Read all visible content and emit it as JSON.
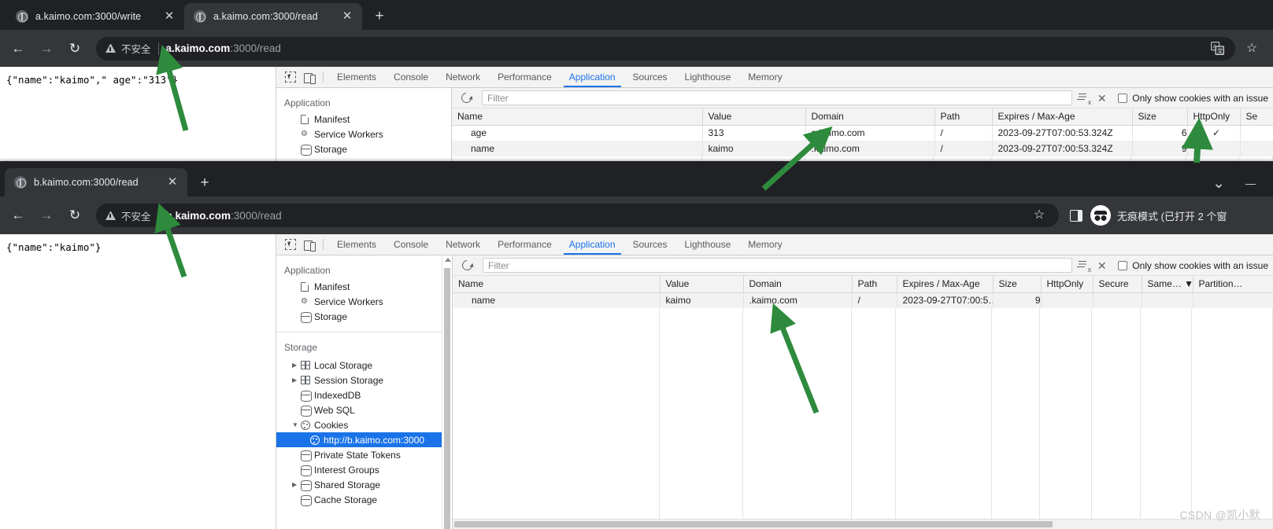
{
  "window_top": {
    "tabs": [
      {
        "title": "a.kaimo.com:3000/write",
        "active": false,
        "favicon": "globe-icon",
        "close": "✕"
      },
      {
        "title": "a.kaimo.com:3000/read",
        "active": true,
        "favicon": "globe-icon",
        "close": "✕"
      }
    ],
    "new_tab_label": "+",
    "toolbar": {
      "back": "←",
      "forward": "→",
      "reload": "↻",
      "not_secure_text": "不安全",
      "url_host": "a.kaimo.com",
      "url_rest": ":3000/read",
      "translate_icon": "translate-icon",
      "star": "☆"
    },
    "page_body": "{\"name\":\"kaimo\",\" age\":\"313\"}",
    "devtools": {
      "tabs": [
        "Elements",
        "Console",
        "Network",
        "Performance",
        "Application",
        "Sources",
        "Lighthouse",
        "Memory"
      ],
      "active_tab": "Application",
      "sidebar": {
        "section_label": "Application",
        "items": [
          {
            "label": "Manifest",
            "icon": "document-icon",
            "arrow": ""
          },
          {
            "label": "Service Workers",
            "icon": "gears-icon",
            "arrow": ""
          },
          {
            "label": "Storage",
            "icon": "database-icon",
            "arrow": ""
          }
        ]
      },
      "cookie_toolbar": {
        "refresh": "refresh-icon",
        "filter_placeholder": "Filter",
        "filter_value": "",
        "clear_filter": "clear-filter-icon",
        "close": "✕",
        "only_issues_label": "Only show cookies with an issue",
        "only_issues_checked": false
      },
      "table": {
        "columns": [
          "Name",
          "Value",
          "Domain",
          "Path",
          "Expires / Max-Age",
          "Size",
          "HttpOnly",
          "Se"
        ],
        "rows": [
          {
            "Name": "age",
            "Value": "313",
            "Domain": "a.kaimo.com",
            "Path": "/",
            "Expires / Max-Age": "2023-09-27T07:00:53.324Z",
            "Size": "6",
            "HttpOnly": "✓",
            "Se": ""
          },
          {
            "Name": "name",
            "Value": "kaimo",
            "Domain": ".kaimo.com",
            "Path": "/",
            "Expires / Max-Age": "2023-09-27T07:00:53.324Z",
            "Size": "9",
            "HttpOnly": "",
            "Se": ""
          }
        ]
      }
    }
  },
  "window_bottom": {
    "tabs": [
      {
        "title": "b.kaimo.com:3000/read",
        "active": true,
        "favicon": "globe-icon",
        "close": "✕"
      }
    ],
    "new_tab_label": "+",
    "window_controls": {
      "minimize_group": "⌄",
      "minimize": "—"
    },
    "toolbar": {
      "back": "←",
      "forward": "→",
      "reload": "↻",
      "not_secure_text": "不安全",
      "url_host": "b.kaimo.com",
      "url_rest": ":3000/read",
      "star": "☆",
      "side_panel": "side-panel-icon",
      "incognito_text": "无痕模式 (已打开 2 个窗"
    },
    "page_body": "{\"name\":\"kaimo\"}",
    "devtools": {
      "tabs": [
        "Elements",
        "Console",
        "Network",
        "Performance",
        "Application",
        "Sources",
        "Lighthouse",
        "Memory"
      ],
      "active_tab": "Application",
      "sidebar": {
        "application_label": "Application",
        "application_items": [
          {
            "label": "Manifest",
            "icon": "document-icon",
            "arrow": ""
          },
          {
            "label": "Service Workers",
            "icon": "gears-icon",
            "arrow": ""
          },
          {
            "label": "Storage",
            "icon": "database-icon",
            "arrow": ""
          }
        ],
        "storage_label": "Storage",
        "storage_items": [
          {
            "label": "Local Storage",
            "icon": "grid-icon",
            "arrow": "▶",
            "indent": 1,
            "selected": false
          },
          {
            "label": "Session Storage",
            "icon": "grid-icon",
            "arrow": "▶",
            "indent": 1,
            "selected": false
          },
          {
            "label": "IndexedDB",
            "icon": "database-icon",
            "arrow": "",
            "indent": 1,
            "selected": false
          },
          {
            "label": "Web SQL",
            "icon": "database-icon",
            "arrow": "",
            "indent": 1,
            "selected": false
          },
          {
            "label": "Cookies",
            "icon": "cookie-icon",
            "arrow": "▼",
            "indent": 1,
            "selected": false
          },
          {
            "label": "http://b.kaimo.com:3000",
            "icon": "cookie-icon",
            "arrow": "",
            "indent": 2,
            "selected": true
          },
          {
            "label": "Private State Tokens",
            "icon": "database-icon",
            "arrow": "",
            "indent": 1,
            "selected": false
          },
          {
            "label": "Interest Groups",
            "icon": "database-icon",
            "arrow": "",
            "indent": 1,
            "selected": false
          },
          {
            "label": "Shared Storage",
            "icon": "database-icon",
            "arrow": "▶",
            "indent": 1,
            "selected": false
          },
          {
            "label": "Cache Storage",
            "icon": "database-icon",
            "arrow": "",
            "indent": 1,
            "selected": false
          }
        ]
      },
      "cookie_toolbar": {
        "refresh": "refresh-icon",
        "filter_placeholder": "Filter",
        "filter_value": "",
        "clear_filter": "clear-filter-icon",
        "close": "✕",
        "only_issues_label": "Only show cookies with an issue",
        "only_issues_checked": false
      },
      "table": {
        "columns": [
          "Name",
          "Value",
          "Domain",
          "Path",
          "Expires / Max-Age",
          "Size",
          "HttpOnly",
          "Secure",
          "Same… ▼",
          "Partition…"
        ],
        "rows": [
          {
            "Name": "name",
            "Value": "kaimo",
            "Domain": ".kaimo.com",
            "Path": "/",
            "Expires / Max-Age": "2023-09-27T07:00:5…",
            "Size": "9",
            "HttpOnly": "",
            "Secure": "",
            "Same": "",
            "Partition": ""
          }
        ]
      }
    }
  },
  "watermark": "CSDN @凯小默",
  "colors": {
    "chrome_dark": "#202124",
    "chrome_toolbar": "#35363a",
    "accent_blue": "#1a73e8",
    "arrow_green": "#2e8b3d"
  }
}
